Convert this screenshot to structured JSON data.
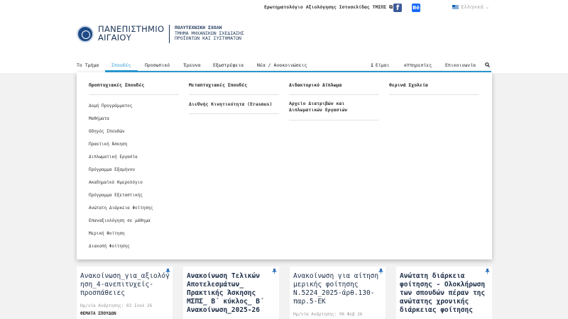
{
  "topbar": {
    "survey_link": "Ερωτηματολόγιο Αξιολόγησης Ιστοσελίδας ΤΜΣΠΣ",
    "facebook": "f",
    "behance": "Bē",
    "language": "Ελληνικά"
  },
  "logo": {
    "line1": "ΠΑΝΕΠΙΣΤΗΜΙΟ",
    "line2": "ΑΙΓΑΙΟΥ"
  },
  "school": {
    "title": "ΠΟΛΥΤΕΧΝΙΚΗ ΣΧΟΛΗ",
    "line1": "ΤΜΗΜΑ ΜΗΧΑΝΙΚΩΝ ΣΧΕΔΙΑΣΗΣ",
    "line2": "ΠΡΟΪΟΝΤΩΝ ΚΑΙ ΣΥΣΤΗΜΑΤΩΝ"
  },
  "nav": {
    "items": [
      "Το Τμήμα",
      "Σπουδές",
      "Προσωπικό",
      "Έρευνα",
      "Εξωστρέφεια",
      "Νέα / Ανακοινώσεις"
    ],
    "right": [
      "Είμαι",
      "eΥπηρεσίες",
      "Επικοινωνία"
    ]
  },
  "mega": {
    "undergrad": {
      "heading": "Προπτυχιακές Σπουδές",
      "links": [
        "Δομή Προγράμματος",
        "Μαθήματα",
        "Οδηγός Σπουδών",
        "Πρακτική Άσκηση",
        "Διπλωματική Εργασία",
        "Πρόγραμμα Εξαμήνου",
        "Ακαδημαϊκό Ημερολόγιο",
        "Πρόγραμμα Εξεταστικής",
        "Ανώτατη Διάρκεια Φοίτησης",
        "Επαναξιολόγηση σε μάθημα",
        "Μερική Φοίτηση",
        "Διακοπή Φοίτησης"
      ]
    },
    "postgrad": {
      "heading": "Μεταπτυχιακές Σπουδές",
      "links": [
        "Διεθνής Κινητικότητα (Erasmus)"
      ]
    },
    "phd": {
      "heading": "Διδακτορικό Δίπλωμα",
      "links": [
        "Αρχείο Διατριβών και Διπλωματικών Εργασιών"
      ]
    },
    "summer": {
      "heading": "Θερινά Σχολεία"
    }
  },
  "cards": [
    {
      "title": "Ανακοίνωση_για_αξιολόγηση_4-ανεπιτυχείς-προσπάθειες",
      "date": "Ημ/νία Ανάρτησης: 03 Ιουλ 26",
      "tag": "ΘΕΜΑΤΑ ΣΠΟΥΔΩΝ"
    },
    {
      "title": "Ανακοίνωση Τελικών Αποτελεσμάτων_ Πρακτικής Άσκησης ΜΣΠΣ_ Β΄ κύκλος_ Β΄ Ανακοίνωση_2025-26"
    },
    {
      "title": "Ανακοίνωση για αίτηση μερικής φοίτησης Ν.5224_2025-άρθ.130-παρ.5-ΕΚ",
      "date": "Ημ/νία Ανάρτησης: 06 Φεβ 26"
    },
    {
      "title": "Ανώτατη διάρκεια φοίτησης - Ολοκλήρωση των σπουδών πέραν της ανώτατης χρονικής διάρκειας φοίτησης"
    }
  ]
}
